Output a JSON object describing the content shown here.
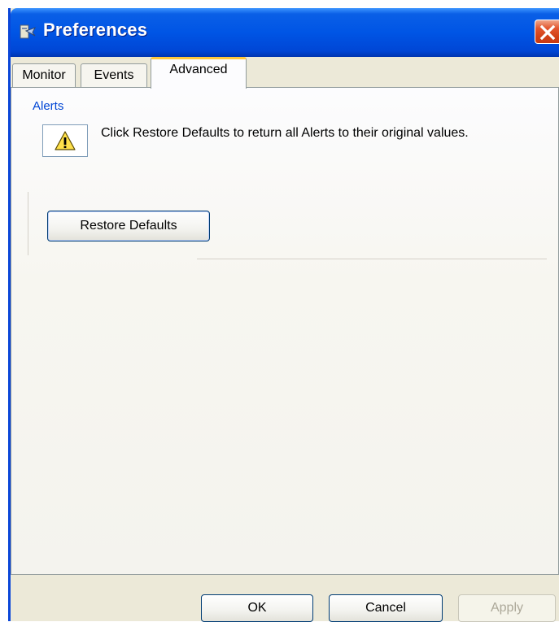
{
  "window": {
    "title": "Preferences"
  },
  "tabs": [
    {
      "label": "Monitor",
      "active": false
    },
    {
      "label": "Events",
      "active": false
    },
    {
      "label": "Advanced",
      "active": true
    }
  ],
  "alerts": {
    "section_title": "Alerts",
    "message": "Click Restore Defaults to return all Alerts to their original values.",
    "restore_button": "Restore Defaults"
  },
  "footer": {
    "ok": "OK",
    "cancel": "Cancel",
    "apply": "Apply"
  },
  "colors": {
    "titlebar": "#0055E5",
    "section_title": "#0046D5",
    "close_button": "#D24118",
    "active_tab_highlight": "#FFC83C"
  }
}
